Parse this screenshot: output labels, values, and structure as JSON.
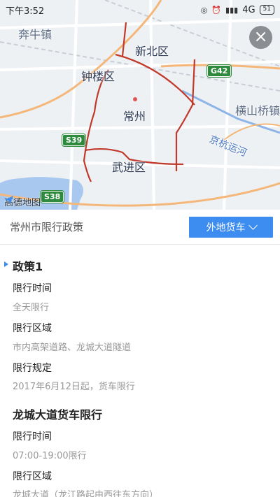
{
  "status_bar": {
    "time": "下午3:52",
    "network": "4G",
    "battery": "51"
  },
  "map": {
    "labels": {
      "benniu": "奔牛镇",
      "xinbei": "新北区",
      "zhonglou": "钟楼区",
      "changzhou": "常州",
      "hengshanqiao": "横山桥镇",
      "wujin": "武进区",
      "canal": "京杭运河"
    },
    "shields": {
      "g42": "G42",
      "s39_upper": "S39",
      "s38": "S38"
    },
    "watermark": "高德地图",
    "close_icon": "close-icon"
  },
  "header": {
    "city_title": "常州市限行政策",
    "vehicle_type": "外地货车"
  },
  "policies": [
    {
      "title": "政策1",
      "time_label": "限行时间",
      "time_value": "全天限行",
      "area_label": "限行区域",
      "area_value": "市内高架道路、龙城大道隧道",
      "rule_label": "限行规定",
      "rule_value": "2017年6月12日起，货车限行"
    },
    {
      "title": "龙城大道货车限行",
      "time_label": "限行时间",
      "time_value": "07:00-19:00限行",
      "area_label": "限行区域",
      "area_value": "龙城大道（龙江路起由西往东方向）"
    }
  ],
  "colors": {
    "accent": "#3d8cf0",
    "restricted_road": "#c0392b",
    "highway_shield": "#2e8b3d"
  }
}
